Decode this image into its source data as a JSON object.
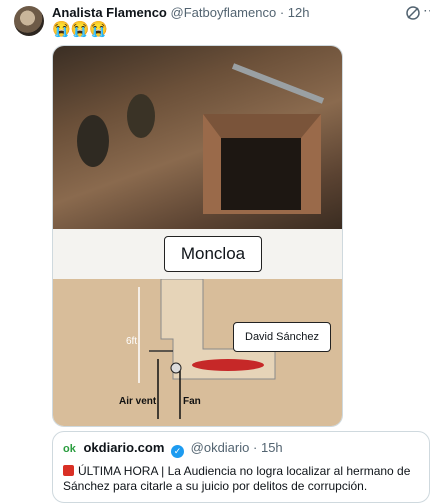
{
  "tweet": {
    "author_name": "Analista Flamenco",
    "handle": "@Fatboyflamenco",
    "separator": "·",
    "time": "12h",
    "text": "😭😭😭"
  },
  "media": {
    "label_moncloa": "Moncloa",
    "label_person": "David Sánchez",
    "label_depth": "6ft",
    "label_vent": "Air vent",
    "label_fan": "Fan"
  },
  "quote": {
    "logo": "ok",
    "author_name": "okdiario.com",
    "handle": "@okdiario",
    "separator": "·",
    "time": "15h",
    "text": "ÚLTIMA HORA | La Audiencia no logra localizar al hermano de Sánchez para citarle a su juicio por delitos de corrupción."
  },
  "icons": {
    "avatar": "avatar",
    "grok": "grok-icon",
    "more": "more-icon",
    "verified": "verified-badge-icon",
    "alert": "rotating-light-icon"
  },
  "colors": {
    "verified": "#1d9bf0",
    "handle_gray": "#536471",
    "okdiario_green": "#2a9d3f",
    "alert_red": "#d93025"
  }
}
